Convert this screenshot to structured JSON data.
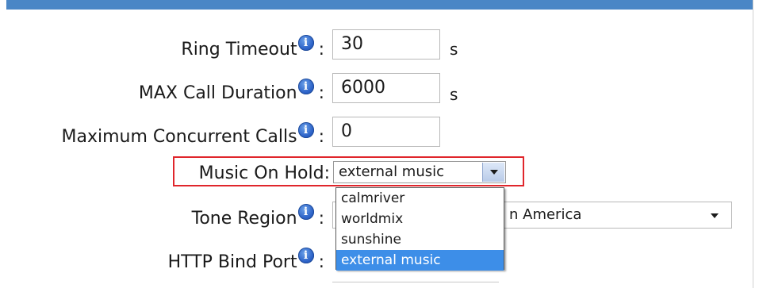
{
  "rows": {
    "ring_timeout": {
      "label": "Ring Timeout",
      "value": "30",
      "unit": "s"
    },
    "max_call_duration": {
      "label": "MAX Call Duration",
      "value": "6000",
      "unit": "s"
    },
    "max_concurrent_calls": {
      "label": "Maximum Concurrent Calls",
      "value": "0"
    },
    "music_on_hold": {
      "label": "Music On Hold",
      "selected": "external music"
    },
    "tone_region": {
      "label": "Tone Region",
      "value_partial": "n America"
    },
    "http_bind_port": {
      "label": "HTTP Bind Port"
    }
  },
  "colon": ":",
  "info_glyph": "i",
  "music_options": [
    "calmriver",
    "worldmix",
    "sunshine",
    "external music"
  ],
  "colors": {
    "top_bar": "#4a86c6",
    "highlight_box": "#e0262c",
    "selected_option": "#3d8ee8",
    "info_icon": "#2d63c8"
  }
}
